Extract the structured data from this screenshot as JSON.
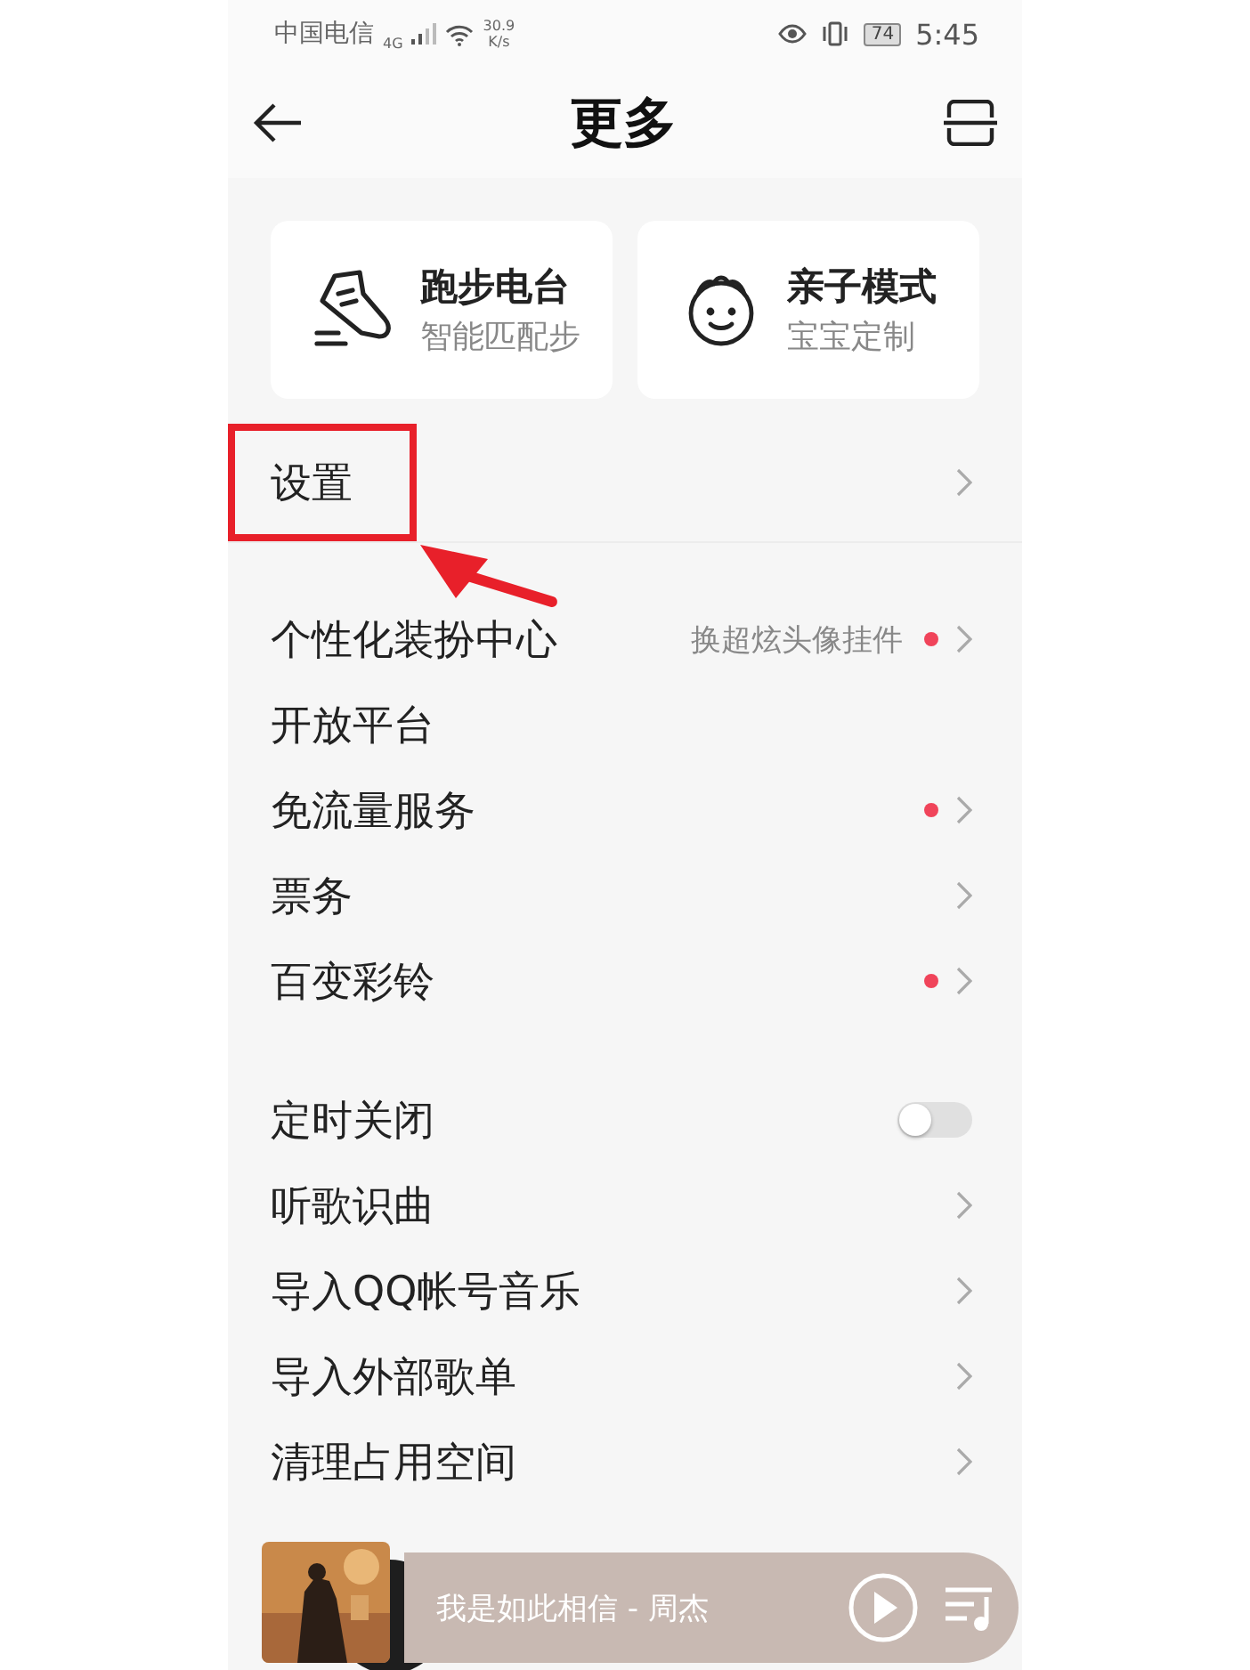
{
  "status_bar": {
    "carrier": "中国电信",
    "network": "4G",
    "speed": "30.9",
    "speed_unit": "K/s",
    "battery": "74",
    "time": "5:45"
  },
  "header": {
    "title": "更多"
  },
  "cards": [
    {
      "kind": "running",
      "title": "跑步电台",
      "subtitle": "智能匹配步"
    },
    {
      "kind": "child",
      "title": "亲子模式",
      "subtitle": "宝宝定制"
    }
  ],
  "settings_row": {
    "label": "设置",
    "highlighted": true
  },
  "groups": [
    [
      {
        "kind": "link",
        "label": "个性化装扮中心",
        "hint": "换超炫头像挂件",
        "dot": true,
        "chevron": true
      },
      {
        "kind": "link",
        "label": "开放平台",
        "dot": false,
        "chevron": false
      },
      {
        "kind": "link",
        "label": "免流量服务",
        "dot": true,
        "chevron": true
      },
      {
        "kind": "link",
        "label": "票务",
        "dot": false,
        "chevron": true
      },
      {
        "kind": "link",
        "label": "百变彩铃",
        "dot": true,
        "chevron": true
      }
    ],
    [
      {
        "kind": "toggle",
        "label": "定时关闭",
        "on": false
      },
      {
        "kind": "link",
        "label": "听歌识曲",
        "dot": false,
        "chevron": true
      },
      {
        "kind": "link",
        "label": "导入QQ帐号音乐",
        "dot": false,
        "chevron": true
      },
      {
        "kind": "link",
        "label": "导入外部歌单",
        "dot": false,
        "chevron": true
      },
      {
        "kind": "link",
        "label": "清理占用空间",
        "dot": false,
        "chevron": true
      }
    ]
  ],
  "mini_player": {
    "track": "我是如此相信 - 周杰"
  }
}
